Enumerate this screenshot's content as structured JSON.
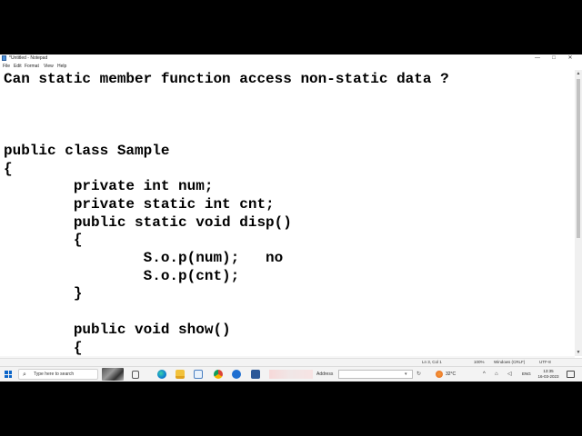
{
  "window": {
    "title": "*Untitled - Notepad",
    "minimize_glyph": "—",
    "maximize_glyph": "□",
    "close_glyph": "✕"
  },
  "menu": {
    "items": [
      "File",
      "Edit",
      "Format",
      "View",
      "Help"
    ]
  },
  "editor": {
    "lines": [
      {
        "row": 0,
        "text": "Can static member function access non-static data ?"
      },
      {
        "row": 4,
        "text": "public class Sample"
      },
      {
        "row": 5,
        "text": "{"
      },
      {
        "row": 6,
        "text": "        private int num;"
      },
      {
        "row": 7,
        "text": "        private static int cnt;"
      },
      {
        "row": 8,
        "text": "        public static void disp()"
      },
      {
        "row": 9,
        "text": "        {"
      },
      {
        "row": 10,
        "text": "                S.o.p(num);   no"
      },
      {
        "row": 11,
        "text": "                S.o.p(cnt);"
      },
      {
        "row": 12,
        "text": "        }"
      },
      {
        "row": 14,
        "text": "        public void show()"
      },
      {
        "row": 15,
        "text": "        {"
      }
    ]
  },
  "statusbar": {
    "position": "Ln 3, Col 1",
    "zoom": "100%",
    "line_ending": "Windows (CRLF)",
    "encoding": "UTF-8"
  },
  "taskbar": {
    "search_icon_glyph": "⌕",
    "search_placeholder": "Type here to search",
    "address_label": "Address",
    "address_dropdown_glyph": "▾",
    "address_go_glyph": "↻",
    "weather": "32°C",
    "tray": {
      "chevron_glyph": "^",
      "network_glyph": "⌂",
      "volume_glyph": "◁",
      "language": "ENG"
    },
    "clock": {
      "time": "13:35",
      "date": "16-03-2023"
    }
  },
  "scrollbar": {
    "up_glyph": "▲",
    "down_glyph": "▼"
  },
  "colors": {
    "start_blue": "#0a64c8",
    "editor_bg": "#ffffff",
    "text": "#000000"
  }
}
